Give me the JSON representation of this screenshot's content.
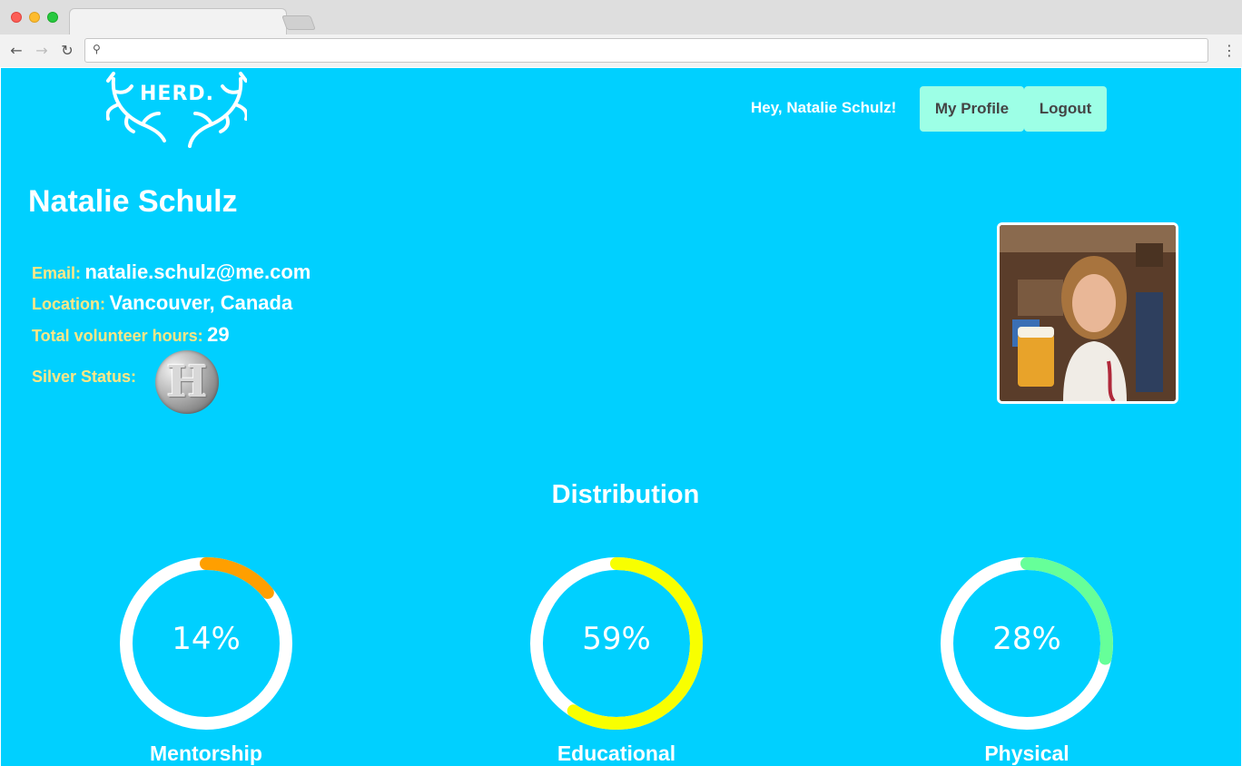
{
  "browser": {
    "address": ""
  },
  "header": {
    "logo_text": "HERD.",
    "greeting": "Hey, Natalie Schulz!",
    "my_profile": "My Profile",
    "logout": "Logout"
  },
  "profile": {
    "name": "Natalie Schulz",
    "email_label": "Email:",
    "email": "natalie.schulz@me.com",
    "location_label": "Location:",
    "location": "Vancouver, Canada",
    "hours_label": "Total volunteer hours:",
    "hours": "29",
    "status_label": "Silver Status:",
    "badge_letter": "H"
  },
  "distribution": {
    "title": "Distribution",
    "items": [
      {
        "label": "Mentorship",
        "percent_text": "14%",
        "percent": 14,
        "color": "#ff9f00"
      },
      {
        "label": "Educational",
        "percent_text": "59%",
        "percent": 59,
        "color": "#f8ff00"
      },
      {
        "label": "Physical",
        "percent_text": "28%",
        "percent": 28,
        "color": "#66ff99"
      }
    ]
  },
  "colors": {
    "page_bg": "#00d0ff",
    "label": "#ffe785",
    "button_bg": "#9dffe6"
  }
}
